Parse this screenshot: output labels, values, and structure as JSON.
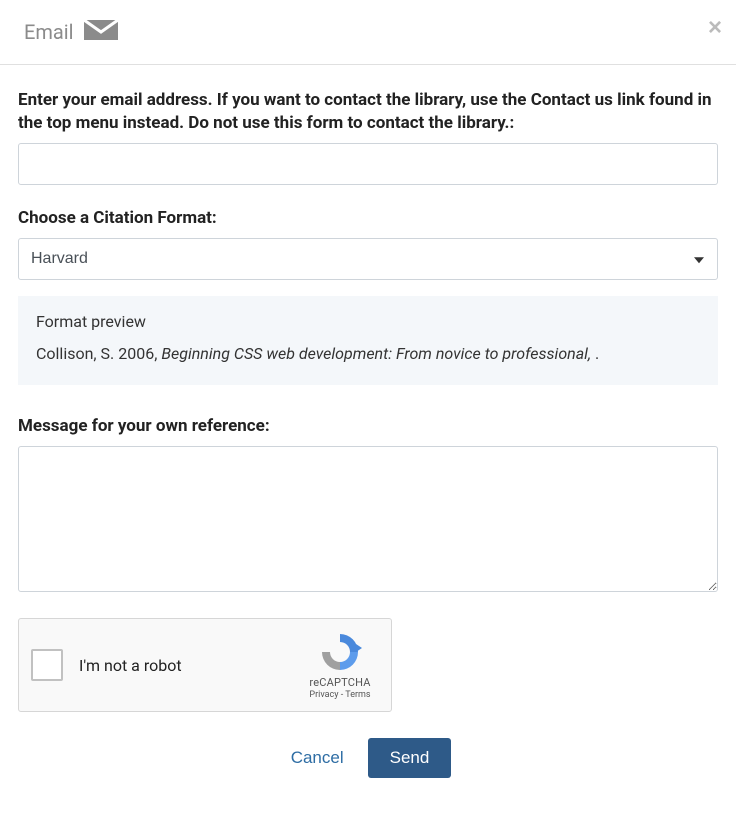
{
  "header": {
    "title": "Email",
    "close_label": "Close"
  },
  "form": {
    "email_label": "Enter your email address. If you want to contact the library, use the Contact us link found in the top menu instead. Do not use this form to contact the library.:",
    "email_value": "",
    "citation_label": "Choose a Citation Format:",
    "citation_selected": "Harvard",
    "preview_label": "Format preview",
    "citation_author_year": "Collison, S. 2006, ",
    "citation_title": "Beginning CSS web development: From novice to professional, ",
    "citation_tail": ".",
    "message_label": "Message for your own reference:",
    "message_value": ""
  },
  "recaptcha": {
    "label": "I'm not a robot",
    "brand": "reCAPTCHA",
    "privacy": "Privacy",
    "separator": " - ",
    "terms": "Terms"
  },
  "actions": {
    "cancel": "Cancel",
    "send": "Send"
  }
}
